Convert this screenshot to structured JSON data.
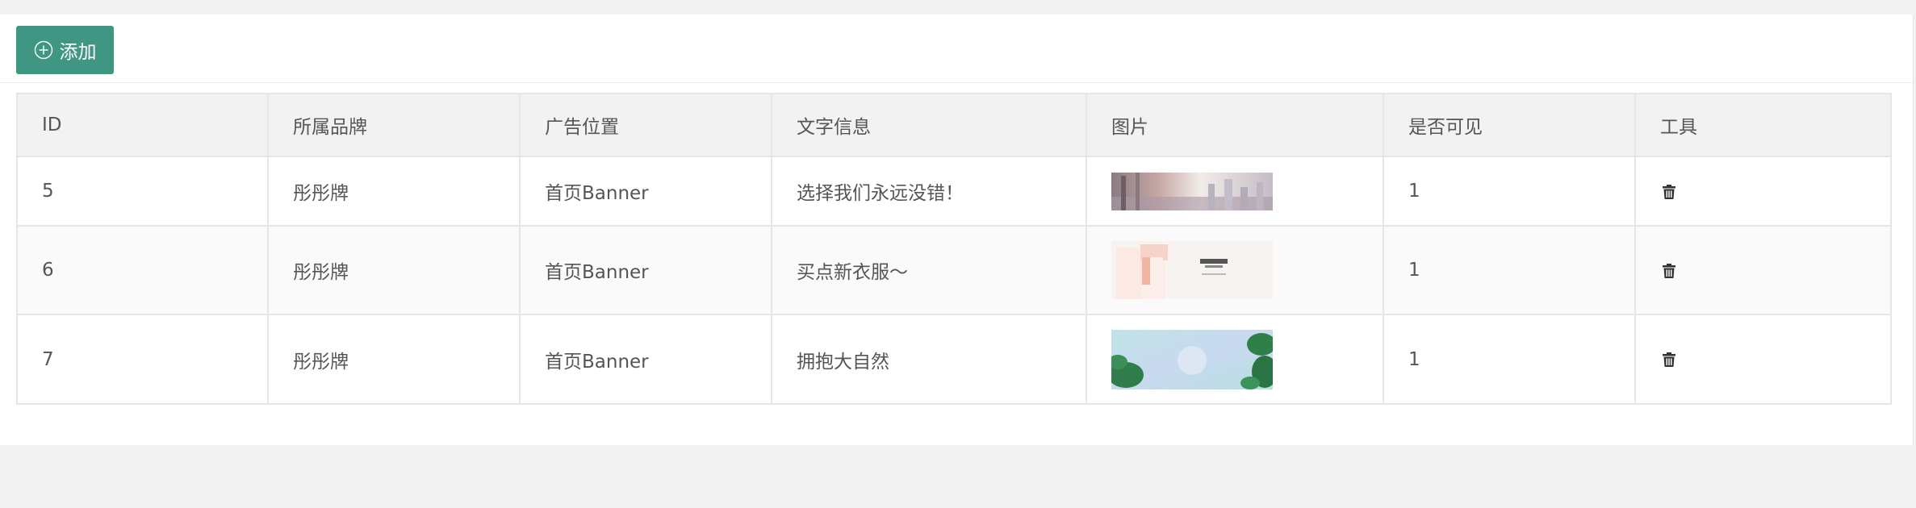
{
  "toolbar": {
    "add_label": "添加",
    "add_icon": "plus-circle-icon"
  },
  "table": {
    "headers": [
      "ID",
      "所属品牌",
      "广告位置",
      "文字信息",
      "图片",
      "是否可见",
      "工具"
    ],
    "rows": [
      {
        "id": "5",
        "brand": "彤彤牌",
        "position": "首页Banner",
        "text": "选择我们永远没错！",
        "visible": "1",
        "image_desc": "city-skyline-banner",
        "tool_icon": "trash-icon"
      },
      {
        "id": "6",
        "brand": "彤彤牌",
        "position": "首页Banner",
        "text": "买点新衣服～",
        "visible": "1",
        "image_desc": "fashion-pink-banner",
        "tool_icon": "trash-icon"
      },
      {
        "id": "7",
        "brand": "彤彤牌",
        "position": "首页Banner",
        "text": "拥抱大自然",
        "visible": "1",
        "image_desc": "nature-leaves-banner",
        "tool_icon": "trash-icon"
      }
    ]
  },
  "colors": {
    "accent": "#3f9683",
    "page_bg": "#f2f2f2",
    "header_bg": "#f2f2f2",
    "border": "#e6e6e6"
  }
}
